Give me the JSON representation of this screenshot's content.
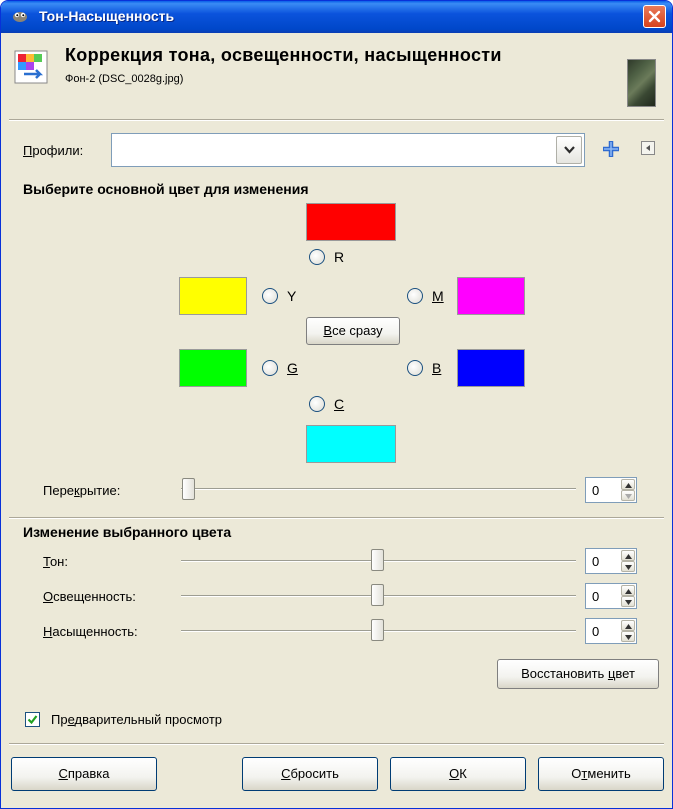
{
  "window": {
    "title": "Тон-Насыщенность"
  },
  "header": {
    "title": "Коррекция тона, освещенности, насыщенности",
    "subtitle": "Фон-2 (DSC_0028g.jpg)"
  },
  "profiles": {
    "label_u": "П",
    "label_rest": "рофили:",
    "value": ""
  },
  "color_select": {
    "heading": "Выберите основной цвет для изменения",
    "r_label": "R",
    "y_label": "Y",
    "m_label": "M",
    "g_label": "G",
    "b_label": "B",
    "c_label": "C",
    "all_btn_u": "В",
    "all_btn_rest": "се сразу",
    "colors": {
      "R": "#ff0000",
      "Y": "#ffff00",
      "M": "#ff00ff",
      "G": "#00ff00",
      "B": "#0000ff",
      "C": "#00ffff"
    }
  },
  "overlap": {
    "label_pre": "Пере",
    "label_u": "к",
    "label_rest": "рытие:",
    "value": "0",
    "level_percent": 0
  },
  "adjust": {
    "heading": "Изменение выбранного цвета",
    "hue_u": "Т",
    "hue_rest": "он:",
    "hue_value": "0",
    "light_u": "О",
    "light_rest": "свещенность:",
    "light_value": "0",
    "sat_u": "Н",
    "sat_rest": "асыщенность:",
    "sat_value": "0",
    "reset_color_pre": "Восстановить ",
    "reset_color_u": "ц",
    "reset_color_rest": "вет"
  },
  "preview": {
    "label_pre": "Пр",
    "label_u": "е",
    "label_rest": "дварительный просмотр",
    "checked": true
  },
  "buttons": {
    "help_u": "С",
    "help_rest": "правка",
    "reset_u": "С",
    "reset_rest": "бросить",
    "ok_u": "О",
    "ok_rest": "К",
    "cancel_pre": "О",
    "cancel_u": "т",
    "cancel_rest": "менить"
  },
  "icons": {
    "app": "gimp-icon",
    "close": "close-icon",
    "header": "hue-saturation-icon",
    "thumbnail": "image-thumbnail",
    "dropdown": "chevron-down-icon",
    "add": "plus-icon",
    "menu": "menu-arrow-icon"
  }
}
